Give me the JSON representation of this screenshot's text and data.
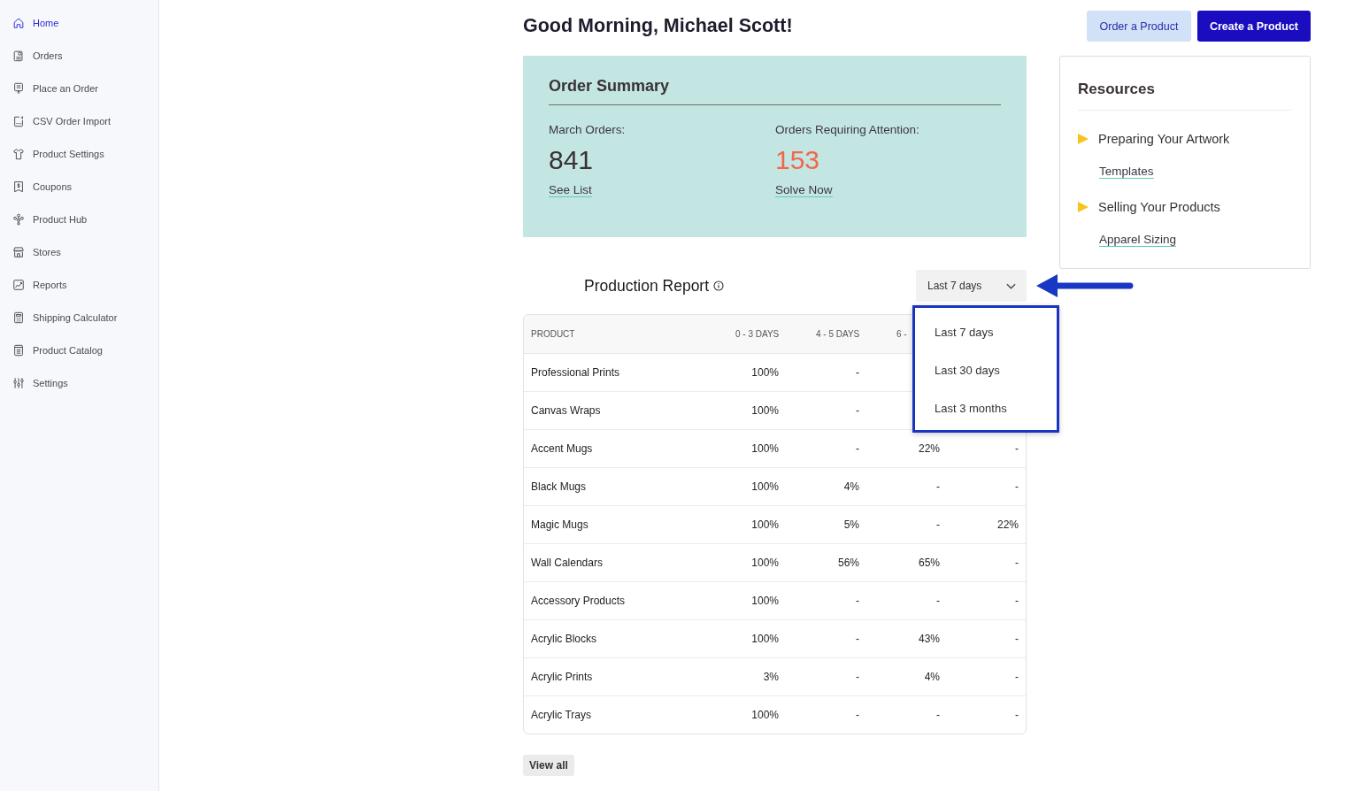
{
  "sidebar": {
    "items": [
      {
        "label": "Home",
        "selected": true
      },
      {
        "label": "Orders",
        "selected": false
      },
      {
        "label": "Place an Order",
        "selected": false
      },
      {
        "label": "CSV Order Import",
        "selected": false
      },
      {
        "label": "Product Settings",
        "selected": false
      },
      {
        "label": "Coupons",
        "selected": false
      },
      {
        "label": "Product Hub",
        "selected": false
      },
      {
        "label": "Stores",
        "selected": false
      },
      {
        "label": "Reports",
        "selected": false
      },
      {
        "label": "Shipping Calculator",
        "selected": false
      },
      {
        "label": "Product Catalog",
        "selected": false
      },
      {
        "label": "Settings",
        "selected": false
      }
    ]
  },
  "header": {
    "greeting": "Good Morning, Michael Scott!",
    "buttons": [
      {
        "label": "Order a Product",
        "kind": "secondary"
      },
      {
        "label": "Create a Product",
        "kind": "primary"
      }
    ]
  },
  "order_summary": {
    "title": "Order Summary",
    "stats": [
      {
        "label": "March Orders:",
        "value": "841",
        "link": "See List",
        "kind": "count"
      },
      {
        "label": "Orders Requiring Attention:",
        "value": "153",
        "link": "Solve Now",
        "kind": "attention"
      }
    ]
  },
  "production_report": {
    "title": "Production Report",
    "period_select": {
      "value": "Last 7 days",
      "menu": [
        "Last 7 days",
        "Last 30 days",
        "Last 3 months"
      ]
    },
    "table": {
      "columns": [
        "PRODUCT",
        "0 - 3 DAYS",
        "4 - 5 DAYS",
        "6 -"
      ],
      "rows": [
        {
          "product": "Professional Prints",
          "values": [
            "100%",
            "-"
          ]
        },
        {
          "product": "Canvas Wraps",
          "values": [
            "100%",
            "-"
          ]
        },
        {
          "product": "Accent Mugs",
          "values": [
            "100%",
            "-",
            "22%",
            "-"
          ]
        },
        {
          "product": "Black Mugs",
          "values": [
            "100%",
            "4%",
            "-",
            "-"
          ]
        },
        {
          "product": "Magic Mugs",
          "values": [
            "100%",
            "5%",
            "-",
            "22%"
          ]
        },
        {
          "product": "Wall Calendars",
          "values": [
            "100%",
            "56%",
            "65%",
            "-"
          ]
        },
        {
          "product": "Accessory Products",
          "values": [
            "100%",
            "-",
            "-",
            "-"
          ]
        },
        {
          "product": "Acrylic Blocks",
          "values": [
            "100%",
            "-",
            "43%",
            "-"
          ]
        },
        {
          "product": "Acrylic Prints",
          "values": [
            "3%",
            "-",
            "4%",
            "-"
          ]
        },
        {
          "product": "Acrylic Trays",
          "values": [
            "100%",
            "-",
            "-",
            "-"
          ]
        }
      ]
    },
    "view_all": "View all"
  },
  "resources": {
    "title": "Resources",
    "sections": [
      {
        "title": "Preparing Your Artwork",
        "links": [
          "Templates"
        ]
      },
      {
        "title": "Selling Your Products",
        "links": [
          "Apparel Sizing"
        ]
      }
    ]
  }
}
